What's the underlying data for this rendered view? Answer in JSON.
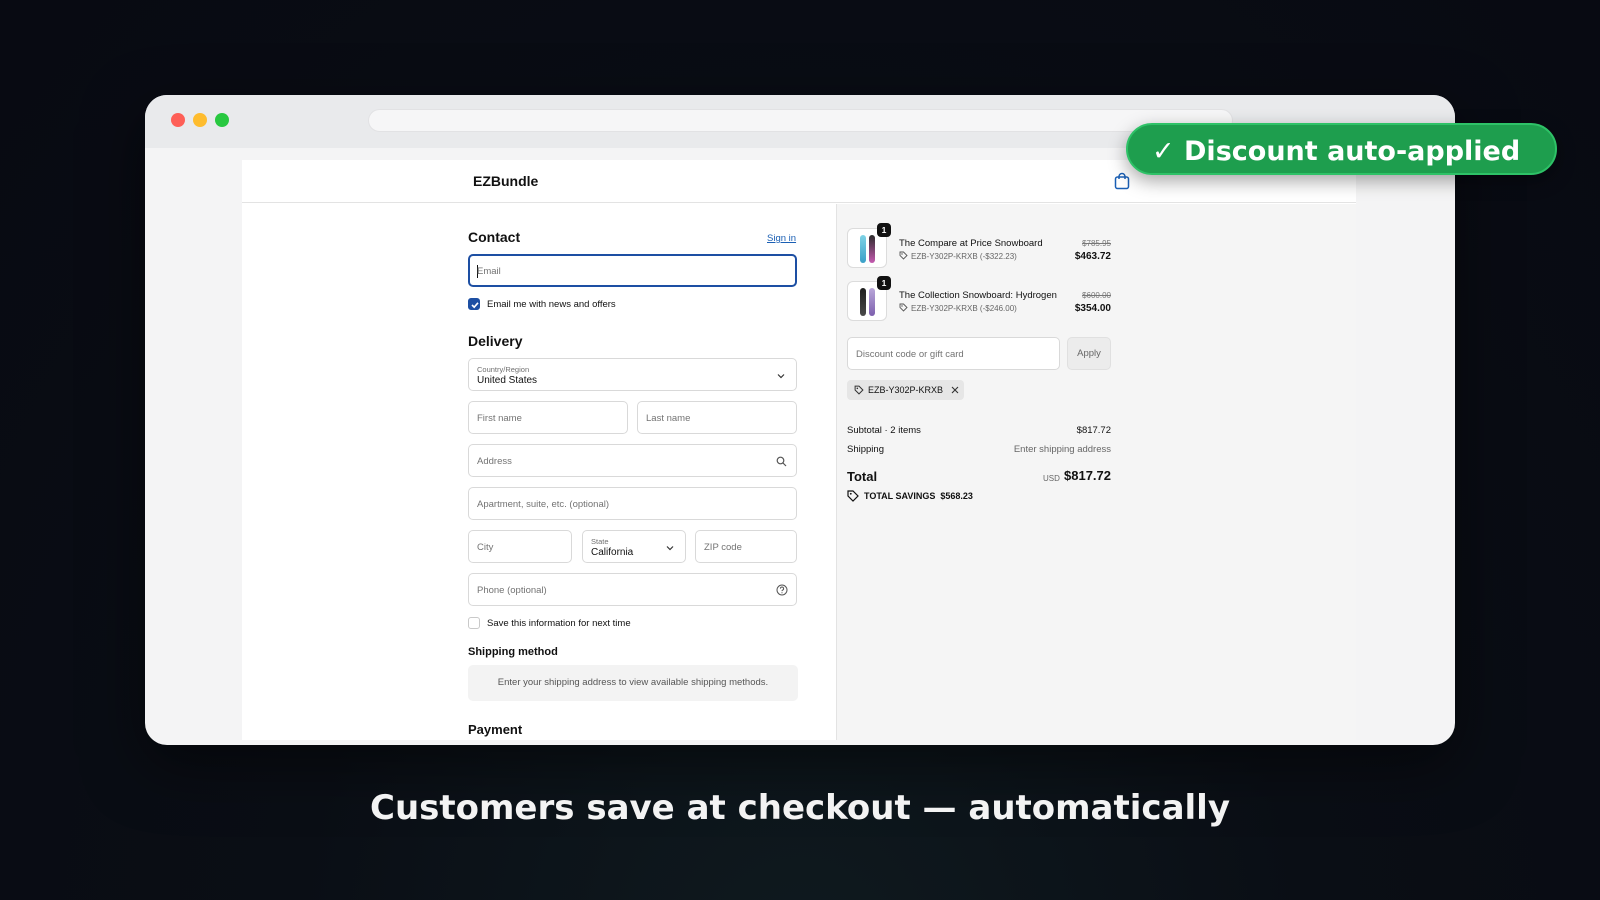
{
  "badge": {
    "text": "✓ Discount auto-applied"
  },
  "caption": "Customers save at checkout — automatically",
  "store": {
    "name": "EZBundle"
  },
  "contact": {
    "title": "Contact",
    "sign_in": "Sign in",
    "email_placeholder": "Email",
    "newsletter_label": "Email me with news and offers",
    "newsletter_checked": true
  },
  "delivery": {
    "title": "Delivery",
    "country_label": "Country/Region",
    "country_value": "United States",
    "first_name": "First name",
    "last_name": "Last name",
    "address": "Address",
    "apartment": "Apartment, suite, etc. (optional)",
    "city": "City",
    "state_label": "State",
    "state_value": "California",
    "zip": "ZIP code",
    "phone": "Phone (optional)",
    "save_info_label": "Save this information for next time",
    "save_info_checked": false
  },
  "shipping_method": {
    "title": "Shipping method",
    "message": "Enter your shipping address to view available shipping methods."
  },
  "payment": {
    "title": "Payment"
  },
  "cart": {
    "items": [
      {
        "name": "The Compare at Price Snowboard",
        "quantity": "1",
        "discount": "EZB-Y302P-KRXB (-$322.23)",
        "original_price": "$785.95",
        "price": "$463.72"
      },
      {
        "name": "The Collection Snowboard: Hydrogen",
        "quantity": "1",
        "discount": "EZB-Y302P-KRXB (-$246.00)",
        "original_price": "$600.00",
        "price": "$354.00"
      }
    ],
    "discount_placeholder": "Discount code or gift card",
    "apply": "Apply",
    "applied_code": "EZB-Y302P-KRXB"
  },
  "summary": {
    "subtotal_label": "Subtotal · 2 items",
    "subtotal_value": "$817.72",
    "shipping_label": "Shipping",
    "shipping_value": "Enter shipping address",
    "total_label": "Total",
    "currency": "USD",
    "total_value": "$817.72",
    "savings_label": "TOTAL SAVINGS",
    "savings_value": "$568.23"
  },
  "colors": {
    "accent": "#1d4fa3",
    "badge": "#1e9e4e",
    "background": "#0a0e15"
  }
}
